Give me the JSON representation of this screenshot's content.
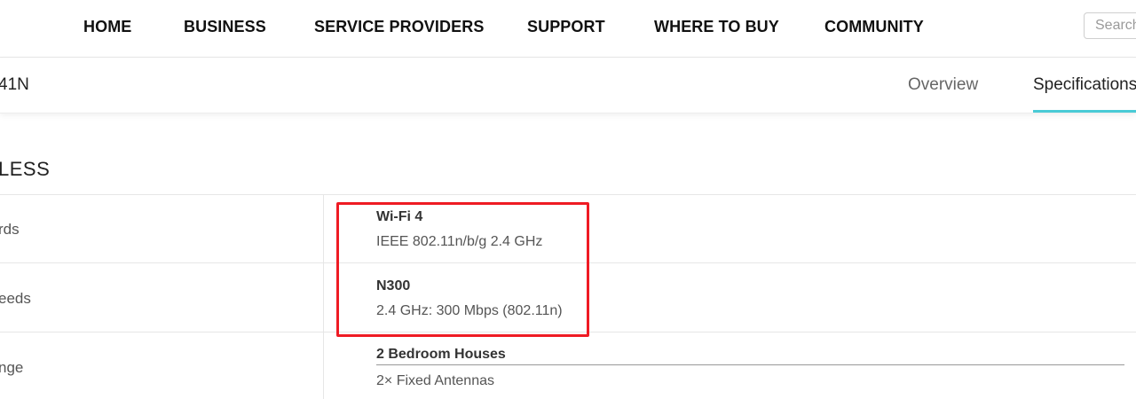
{
  "nav": {
    "items": [
      "HOME",
      "BUSINESS",
      "SERVICE PROVIDERS",
      "SUPPORT",
      "WHERE TO BUY",
      "COMMUNITY"
    ],
    "search_placeholder": "Search"
  },
  "product": {
    "name": "41N",
    "tabs": [
      "Overview",
      "Specifications"
    ],
    "active_tab": "Specifications"
  },
  "section": {
    "title": "LESS"
  },
  "specs": [
    {
      "label": "rds",
      "entries": [
        {
          "title": "Wi-Fi 4",
          "value": "IEEE 802.11n/b/g 2.4 GHz"
        }
      ]
    },
    {
      "label": "eeds",
      "entries": [
        {
          "title": "N300",
          "value": "2.4 GHz: 300 Mbps (802.11n)"
        }
      ]
    },
    {
      "label": "nge",
      "entries": [
        {
          "title": "2 Bedroom Houses",
          "value": "2× Fixed Antennas"
        }
      ]
    }
  ],
  "colors": {
    "accent": "#4acbd6",
    "highlight": "#ef1b24"
  }
}
